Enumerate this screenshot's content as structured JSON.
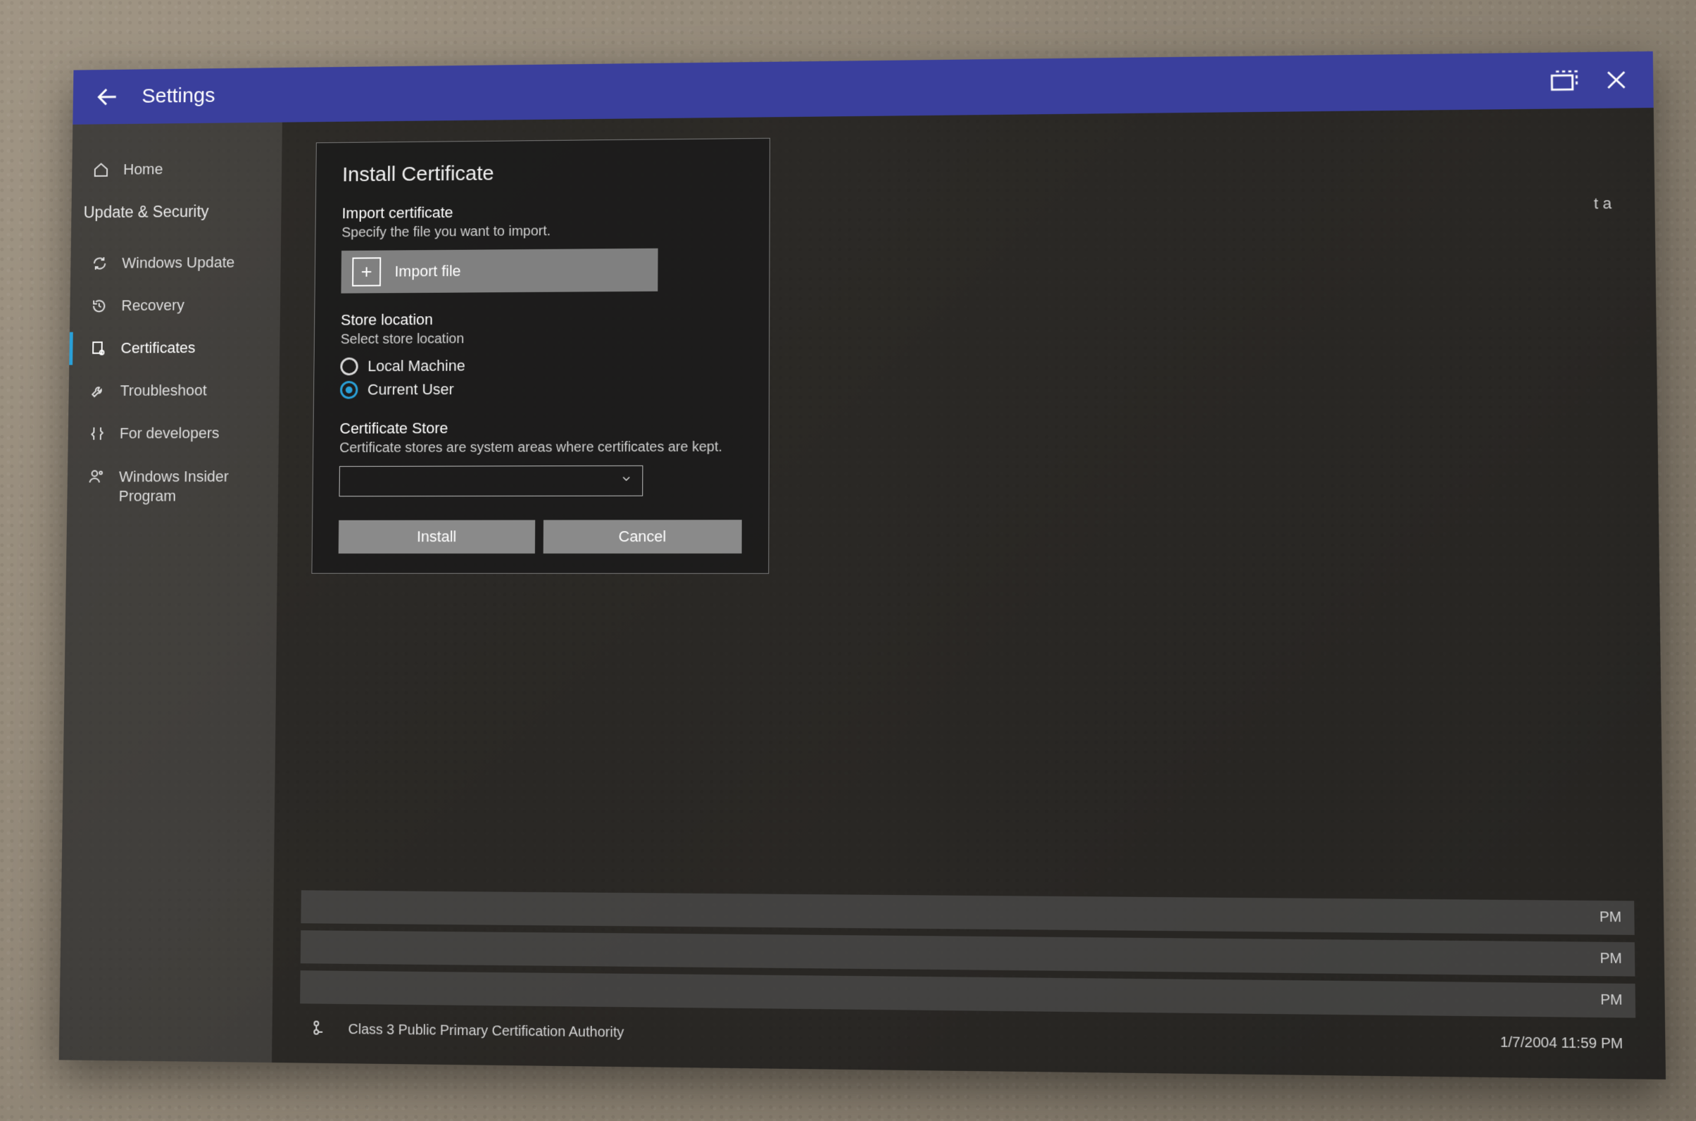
{
  "titlebar": {
    "title": "Settings"
  },
  "sidebar": {
    "home": "Home",
    "category": "Update & Security",
    "items": [
      {
        "label": "Windows Update"
      },
      {
        "label": "Recovery"
      },
      {
        "label": "Certificates"
      },
      {
        "label": "Troubleshoot"
      },
      {
        "label": "For developers"
      },
      {
        "label": "Windows Insider Program"
      }
    ]
  },
  "dialog": {
    "title": "Install Certificate",
    "import": {
      "heading": "Import certificate",
      "subtitle": "Specify the file you want to import.",
      "button": "Import file"
    },
    "store_location": {
      "heading": "Store location",
      "subtitle": "Select store location",
      "options": {
        "local": "Local Machine",
        "current": "Current User"
      },
      "selected": "current"
    },
    "cert_store": {
      "heading": "Certificate Store",
      "subtitle": "Certificate stores are system areas where certificates are kept.",
      "value": ""
    },
    "buttons": {
      "install": "Install",
      "cancel": "Cancel"
    }
  },
  "background": {
    "frag_top": "t a",
    "rows": [
      {
        "suffix": "PM"
      },
      {
        "suffix": "PM"
      },
      {
        "suffix": "PM"
      }
    ],
    "last_row": {
      "name": "Class 3 Public Primary Certification Authority",
      "date": "1/7/2004 11:59 PM"
    }
  }
}
